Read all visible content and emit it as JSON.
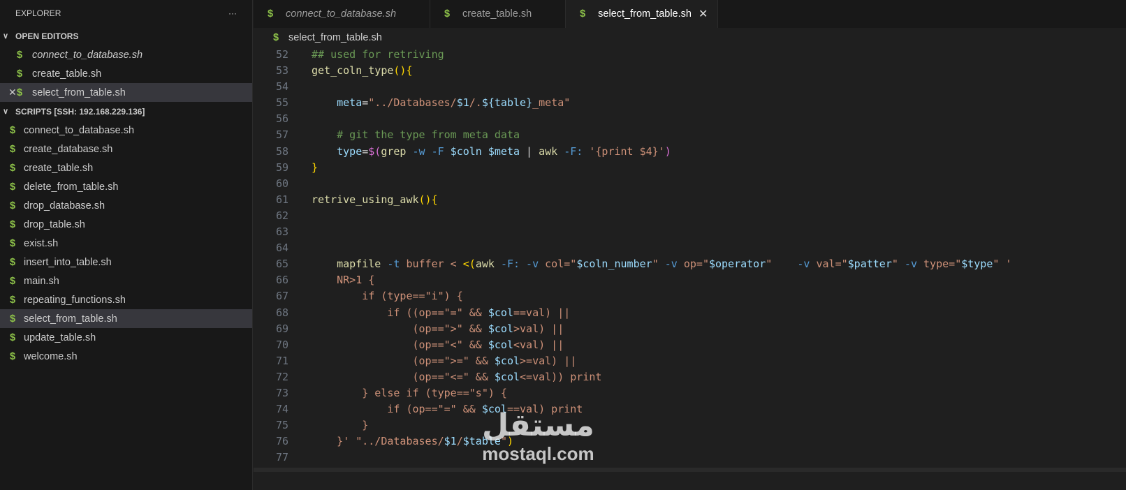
{
  "sidebar": {
    "title": "EXPLORER",
    "more": "···",
    "open_editors_label": "OPEN EDITORS",
    "open_editors": [
      {
        "name": "connect_to_database.sh",
        "italic": true
      },
      {
        "name": "create_table.sh"
      },
      {
        "name": "select_from_table.sh",
        "selected": true
      }
    ],
    "folder_label": "SCRIPTS [SSH: 192.168.229.136]",
    "files": [
      "connect_to_database.sh",
      "create_database.sh",
      "create_table.sh",
      "delete_from_table.sh",
      "drop_database.sh",
      "drop_table.sh",
      "exist.sh",
      "insert_into_table.sh",
      "main.sh",
      "repeating_functions.sh",
      "select_from_table.sh",
      "update_table.sh",
      "welcome.sh"
    ],
    "selected_file": "select_from_table.sh"
  },
  "tabs": [
    {
      "label": "connect_to_database.sh",
      "italic": true
    },
    {
      "label": "create_table.sh"
    },
    {
      "label": "select_from_table.sh",
      "active": true
    }
  ],
  "breadcrumb": "select_from_table.sh",
  "colors": {
    "fn": "#dcdcaa",
    "var": "#9cdcfe",
    "str": "#ce9178",
    "cmt": "#6a9955",
    "opt": "#569cd6",
    "br": "#ffd700",
    "pu": "#da70d6",
    "plain": "#d4d4d4"
  },
  "code": [
    {
      "n": 52,
      "t": [
        [
          "## used for retriving",
          "cmt"
        ]
      ]
    },
    {
      "n": 53,
      "t": [
        [
          "get_coln_type",
          "fn"
        ],
        [
          "()",
          "br"
        ],
        [
          "{",
          "br"
        ]
      ]
    },
    {
      "n": 54,
      "t": []
    },
    {
      "n": 55,
      "t": [
        [
          "    "
        ],
        [
          "meta",
          "var"
        ],
        [
          "="
        ],
        [
          "\"../Databases/",
          "str"
        ],
        [
          "$1",
          "var"
        ],
        [
          "/.",
          "str"
        ],
        [
          "${",
          "var"
        ],
        [
          "table",
          "var"
        ],
        [
          "}",
          "var"
        ],
        [
          "_meta\"",
          "str"
        ]
      ]
    },
    {
      "n": 56,
      "t": []
    },
    {
      "n": 57,
      "t": [
        [
          "    "
        ],
        [
          "# git the type from meta data",
          "cmt"
        ]
      ]
    },
    {
      "n": 58,
      "t": [
        [
          "    "
        ],
        [
          "type",
          "var"
        ],
        [
          "="
        ],
        [
          "$(",
          "pu"
        ],
        [
          "grep ",
          "fn"
        ],
        [
          "-w -F ",
          "opt"
        ],
        [
          "$coln $meta",
          "var"
        ],
        [
          " | "
        ],
        [
          "awk ",
          "fn"
        ],
        [
          "-F:",
          "opt"
        ],
        [
          " "
        ],
        [
          "'{print $4}'",
          "str"
        ],
        [
          ")",
          "pu"
        ]
      ]
    },
    {
      "n": 59,
      "t": [
        [
          "}",
          "br"
        ]
      ]
    },
    {
      "n": 60,
      "t": []
    },
    {
      "n": 61,
      "t": [
        [
          "retrive_using_awk",
          "fn"
        ],
        [
          "()",
          "br"
        ],
        [
          "{",
          "br"
        ]
      ]
    },
    {
      "n": 62,
      "t": []
    },
    {
      "n": 63,
      "t": []
    },
    {
      "n": 64,
      "t": []
    },
    {
      "n": 65,
      "t": [
        [
          "    "
        ],
        [
          "mapfile ",
          "fn"
        ],
        [
          "-t",
          "opt"
        ],
        [
          " buffer < ",
          "str"
        ],
        [
          "<(",
          "br"
        ],
        [
          "awk ",
          "fn"
        ],
        [
          "-F: -v",
          "opt"
        ],
        [
          " col=",
          "str"
        ],
        [
          "\"",
          "str"
        ],
        [
          "$coln_number",
          "var"
        ],
        [
          "\"",
          "str"
        ],
        [
          " -v",
          "opt"
        ],
        [
          " op=",
          "str"
        ],
        [
          "\"",
          "str"
        ],
        [
          "$operator",
          "var"
        ],
        [
          "\"",
          "str"
        ],
        [
          "    -v",
          "opt"
        ],
        [
          " val=",
          "str"
        ],
        [
          "\"",
          "str"
        ],
        [
          "$patter",
          "var"
        ],
        [
          "\"",
          "str"
        ],
        [
          " -v",
          "opt"
        ],
        [
          " type=",
          "str"
        ],
        [
          "\"",
          "str"
        ],
        [
          "$type",
          "var"
        ],
        [
          "\" '",
          "str"
        ]
      ]
    },
    {
      "n": 66,
      "t": [
        [
          "    NR>1 {",
          "str"
        ]
      ]
    },
    {
      "n": 67,
      "t": [
        [
          "        if (type==\"i\") {",
          "str"
        ]
      ]
    },
    {
      "n": 68,
      "t": [
        [
          "            if ((op==\"=\" && ",
          "str"
        ],
        [
          "$col",
          "var"
        ],
        [
          "==val) ||",
          "str"
        ]
      ]
    },
    {
      "n": 69,
      "t": [
        [
          "                (op==\">\" && ",
          "str"
        ],
        [
          "$col",
          "var"
        ],
        [
          ">val) ||",
          "str"
        ]
      ]
    },
    {
      "n": 70,
      "t": [
        [
          "                (op==\"<\" && ",
          "str"
        ],
        [
          "$col",
          "var"
        ],
        [
          "<val) ||",
          "str"
        ]
      ]
    },
    {
      "n": 71,
      "t": [
        [
          "                (op==\">=\" && ",
          "str"
        ],
        [
          "$col",
          "var"
        ],
        [
          ">=val) ||",
          "str"
        ]
      ]
    },
    {
      "n": 72,
      "t": [
        [
          "                (op==\"<=\" && ",
          "str"
        ],
        [
          "$col",
          "var"
        ],
        [
          "<=val)) print",
          "str"
        ]
      ]
    },
    {
      "n": 73,
      "t": [
        [
          "        } else if (type==\"s\") {",
          "str"
        ]
      ]
    },
    {
      "n": 74,
      "t": [
        [
          "            if (op==\"=\" && ",
          "str"
        ],
        [
          "$col",
          "var"
        ],
        [
          "==val) print",
          "str"
        ]
      ]
    },
    {
      "n": 75,
      "t": [
        [
          "        }",
          "str"
        ]
      ]
    },
    {
      "n": 76,
      "t": [
        [
          "    }' \"../Databases/",
          "str"
        ],
        [
          "$1",
          "var"
        ],
        [
          "/",
          "str"
        ],
        [
          "$table",
          "var"
        ],
        [
          "\"",
          "str"
        ],
        [
          ")",
          "br"
        ]
      ]
    },
    {
      "n": 77,
      "t": []
    }
  ],
  "watermark": {
    "arabic": "مستقل",
    "latin": "mostaql.com"
  }
}
